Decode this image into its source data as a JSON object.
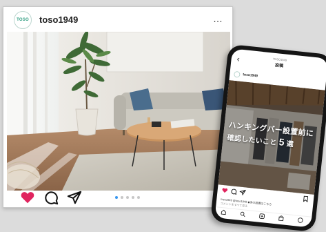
{
  "post": {
    "avatar_text": "TOSO",
    "username": "toso1949",
    "more_label": "…",
    "carousel": {
      "count": 5,
      "active_index": 0
    },
    "icons": [
      "heart-icon",
      "comment-icon",
      "share-icon"
    ]
  },
  "phone": {
    "back_label": "‹",
    "account_label": "TOSO1949",
    "title": "投稿",
    "username": "toso1949",
    "overlay_line1": "ハンキングバー設置前に",
    "overlay_line2": "確認したいこと",
    "overlay_number": "5",
    "overlay_suffix": "選",
    "caption": "toso1949 @toso1949 ◆決の設置はこちら",
    "comments_label": "コメントをすべて見る",
    "icons": [
      "heart-icon",
      "comment-icon",
      "share-icon",
      "bookmark-icon"
    ],
    "nav_icons": [
      "home-icon",
      "search-icon",
      "add-icon",
      "shop-icon",
      "profile-icon"
    ]
  },
  "colors": {
    "heart": "#e0245e",
    "accent": "#3897f0",
    "brand": "#2d9c80"
  }
}
